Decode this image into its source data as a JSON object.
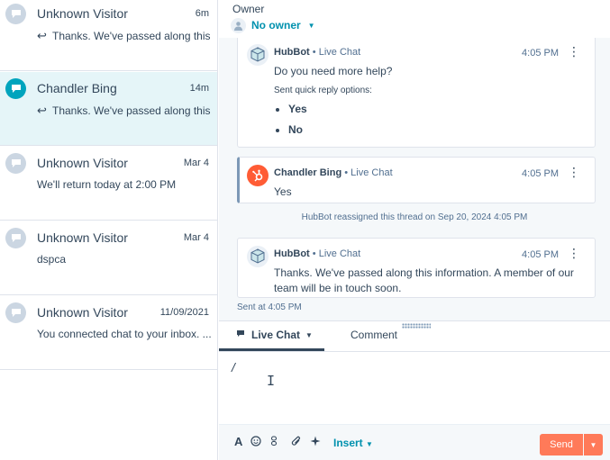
{
  "conversations": [
    {
      "name": "Unknown Visitor",
      "time": "6m",
      "preview": "Thanks. We've passed along this...",
      "is_reply": true
    },
    {
      "name": "Chandler Bing",
      "time": "14m",
      "preview": "Thanks. We've passed along this...",
      "is_reply": true
    },
    {
      "name": "Unknown Visitor",
      "time": "Mar 4",
      "preview": "We'll return today at 2:00 PM",
      "is_reply": false
    },
    {
      "name": "Unknown Visitor",
      "time": "Mar 4",
      "preview": "dspca",
      "is_reply": false
    },
    {
      "name": "Unknown Visitor",
      "time": "11/09/2021",
      "preview": "You connected chat to your inbox. ...",
      "is_reply": false
    }
  ],
  "reply_glyph": "↩",
  "owner": {
    "label": "Owner",
    "value": "No owner"
  },
  "messages": [
    {
      "sender": "HubBot",
      "channel": "Live Chat",
      "time": "4:05 PM",
      "text": "Do you need more help?",
      "sub": "Sent quick reply options:",
      "options": [
        "Yes",
        "No"
      ]
    },
    {
      "sender": "Chandler Bing",
      "channel": "Live Chat",
      "time": "4:05 PM",
      "text": "Yes"
    },
    {
      "sender": "HubBot",
      "channel": "Live Chat",
      "time": "4:05 PM",
      "text": "Thanks. We've passed along this information. A member of our team will be in touch soon."
    }
  ],
  "separator": "•",
  "system_note": "HubBot reassigned this thread on Sep 20, 2024 4:05 PM",
  "sent_at": "Sent at 4:05 PM",
  "composer": {
    "tabs": {
      "live_chat": "Live Chat",
      "comment": "Comment"
    },
    "editor_text": "/",
    "insert_label": "Insert",
    "send_label": "Send"
  },
  "colors": {
    "accent": "#0091ae",
    "active_row": "#e5f5f8",
    "send_button": "#ff7a59",
    "hubspot_orange": "#ff5c35",
    "thread_bg": "#f5f8fa"
  },
  "icons": {
    "chat_avatar": "chat-bubble-icon",
    "bot_avatar": "robot-icon",
    "contact_avatar": "hubspot-sprocket-icon",
    "owner_avatar": "person-icon",
    "kebab": "kebab-menu-icon",
    "text_format": "text-format-icon",
    "emoji": "emoji-icon",
    "snippet": "snippet-icon",
    "attachment": "paperclip-icon",
    "ai_assist": "sparkle-icon",
    "caret": "caret-down-icon"
  }
}
